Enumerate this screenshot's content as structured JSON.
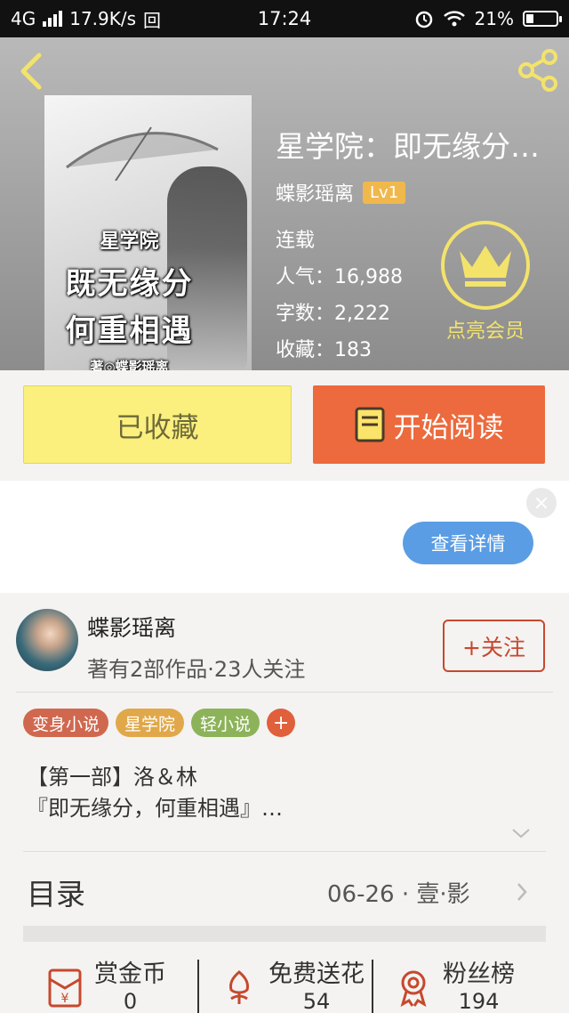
{
  "status_bar": {
    "network": "4G",
    "speed": "17.9K/s",
    "data_icon": "回",
    "time": "17:24",
    "battery": "21%"
  },
  "book": {
    "title": "星学院：即无缘分…",
    "author": "蝶影瑶离",
    "level": "Lv1",
    "status": "连载",
    "popularity_label": "人气：",
    "popularity": "16,988",
    "words_label": "字数：",
    "words": "2,222",
    "favorites_label": "收藏：",
    "favorites": "183",
    "vip_label": "点亮会员",
    "cover": {
      "line1": "星学院",
      "line2": "既无缘分",
      "line3": "何重相遇",
      "line4": "著◎蝶影瑶离"
    }
  },
  "actions": {
    "favorited_label": "已收藏",
    "read_label": "开始阅读"
  },
  "ad": {
    "close_label": "×",
    "details_label": "查看详情"
  },
  "author_card": {
    "name": "蝶影瑶离",
    "stats": "著有2部作品·23人关注",
    "follow_label": "+关注"
  },
  "tags": [
    {
      "label": "变身小说",
      "color": "#d0684f"
    },
    {
      "label": "星学院",
      "color": "#e0a84a"
    },
    {
      "label": "轻小说",
      "color": "#8db35a"
    }
  ],
  "tag_add_label": "+",
  "description": {
    "line1": "【第一部】洛＆林",
    "line2": "『即无缘分，何重相遇』…"
  },
  "toc": {
    "label": "目录",
    "latest": "06-26 · 壹·影"
  },
  "bottom_stats": [
    {
      "label": "赏金币",
      "value": "0",
      "icon": "red-envelope-icon"
    },
    {
      "label": "免费送花",
      "value": "54",
      "icon": "flower-icon"
    },
    {
      "label": "粉丝榜",
      "value": "194",
      "icon": "medal-icon"
    }
  ],
  "colors": {
    "accent_orange": "#ec6a3d",
    "favorite_yellow": "#fbef7e",
    "vip_yellow": "#f3e36b",
    "follow_red": "#c7482d"
  }
}
